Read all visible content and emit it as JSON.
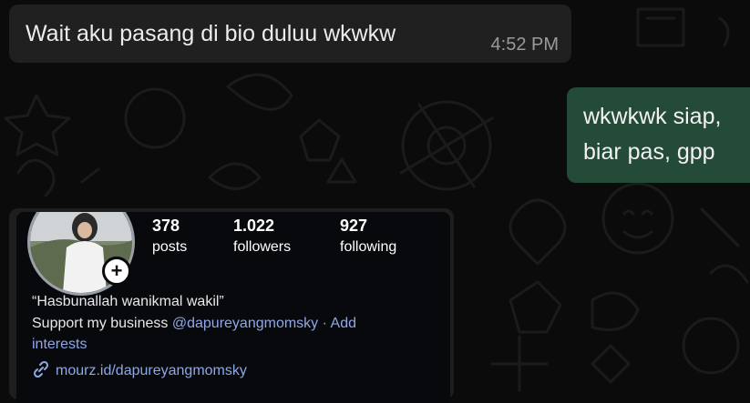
{
  "messages": [
    {
      "direction": "incoming",
      "text": "Wait aku pasang di bio duluu wkwkw",
      "time": "4:52 PM"
    },
    {
      "direction": "outgoing",
      "lines": [
        "wkwkwk siap,",
        "biar pas, gpp"
      ]
    }
  ],
  "profile_card": {
    "posts_count": "378",
    "posts_label": "posts",
    "followers_count": "1.022",
    "followers_label": "followers",
    "following_count": "927",
    "following_label": "following",
    "bio_quote": "“Hasbunallah wanikmal wakil”",
    "bio_prefix": "Support my business",
    "bio_mention": "@dapureyangmomsky",
    "bio_separator": " · ",
    "bio_add": "Add",
    "bio_interests": "interests",
    "link_text": "mourz.id/dapureyangmomsky"
  },
  "colors": {
    "incoming_bubble": "#202020",
    "outgoing_bubble": "#244a38",
    "link": "#8fa8e6"
  }
}
